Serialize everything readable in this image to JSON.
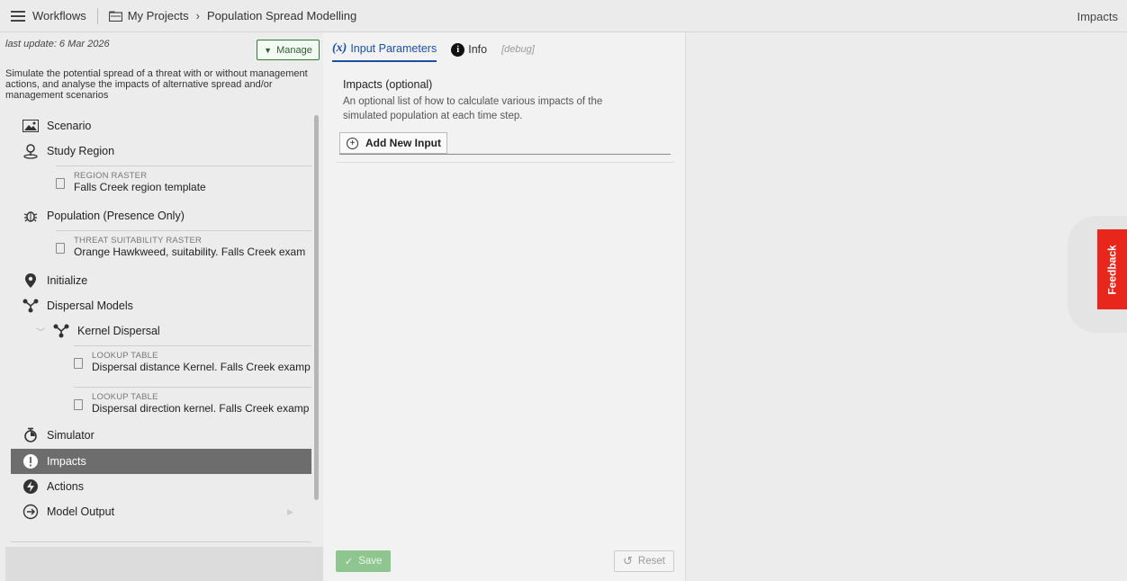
{
  "topbar": {
    "workflows_label": "Workflows",
    "project_label": "My Projects",
    "page_label": "Population Spread Modelling",
    "right_label": "Impacts"
  },
  "sidebar": {
    "last_update": "last update: 6 Mar 2026",
    "manage_label": "Manage",
    "description": "Simulate the potential spread of a threat with or without management actions, and analyse the impacts of alternative spread and/or management scenarios",
    "items": [
      {
        "label": "Scenario",
        "icon": "image-icon"
      },
      {
        "label": "Study Region",
        "icon": "map-pin-icon"
      },
      {
        "label": "Population (Presence Only)",
        "icon": "bug-icon"
      },
      {
        "label": "Initialize",
        "icon": "location-icon"
      },
      {
        "label": "Dispersal Models",
        "icon": "branch-icon"
      },
      {
        "label": "Kernel Dispersal",
        "icon": "branch-icon"
      },
      {
        "label": "Simulator",
        "icon": "stopwatch-icon"
      },
      {
        "label": "Impacts",
        "icon": "alert-icon"
      },
      {
        "label": "Actions",
        "icon": "bolt-icon"
      },
      {
        "label": "Model Output",
        "icon": "arrow-circle-icon"
      }
    ],
    "files": [
      {
        "caption": "REGION RASTER",
        "value": "Falls Creek region template"
      },
      {
        "caption": "THREAT SUITABILITY RASTER",
        "value": "Orange Hawkweed, suitability. Falls Creek exam"
      },
      {
        "caption": "LOOKUP TABLE",
        "value": "Dispersal distance Kernel. Falls Creek examp"
      },
      {
        "caption": "LOOKUP TABLE",
        "value": "Dispersal direction kernel. Falls Creek examp"
      }
    ]
  },
  "main": {
    "tabs": [
      {
        "icon_text": "(x)",
        "label": "Input Parameters"
      },
      {
        "icon_text": "i",
        "label": "Info"
      },
      {
        "label": "[debug]"
      }
    ],
    "param_title": "Impacts (optional)",
    "param_desc": "An optional list of how to calculate various impacts of the simulated population at each time step.",
    "add_label": "Add New Input",
    "save_label": "Save",
    "reset_label": "Reset"
  },
  "feedback_label": "Feedback",
  "colors": {
    "accent_blue": "#1a4fa3",
    "manage_green": "#2e7d32",
    "save_green": "#8fc58f",
    "feedback_red": "#e8261c",
    "selected_gray": "#6d6d6d"
  }
}
